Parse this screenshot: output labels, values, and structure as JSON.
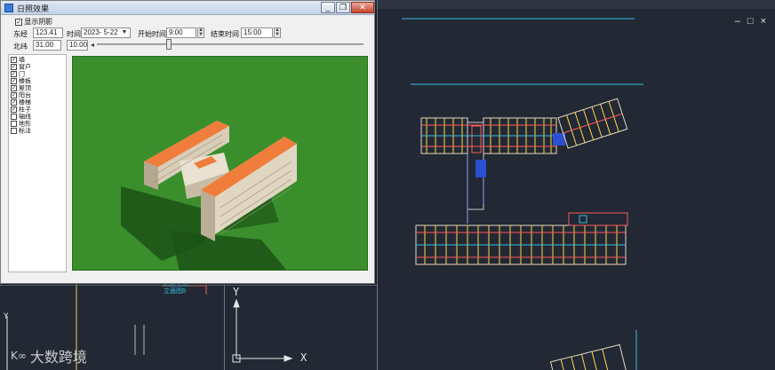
{
  "dialog": {
    "title": "日照效果",
    "show_shadow_label": "显示阴影",
    "show_shadow_checked": true,
    "location_label": "东经",
    "location_value": "123.41",
    "date_label": "时间",
    "date_value": "2023- 5-22",
    "start_label": "开始时间",
    "start_value": "9:00",
    "end_label": "结束时间",
    "end_value": "15:00",
    "lat_label": "北纬",
    "lat_value": "31.00",
    "speed_value": "10.00",
    "slider_level": 0.27,
    "layers": [
      "墙",
      "窗户",
      "门",
      "楼板",
      "屋顶",
      "阳台",
      "楼梯",
      "柱子",
      "轴线",
      "地形",
      "标注"
    ],
    "layers_checked": [
      true,
      true,
      true,
      true,
      true,
      true,
      true,
      true,
      false,
      false,
      false
    ]
  },
  "window_controls": {
    "minimize": "_",
    "restore": "❐",
    "close": "✕"
  },
  "cad": {
    "controls": [
      "–",
      "□",
      "×"
    ],
    "axis_x": "X",
    "axis_y": "Y",
    "label_lines": [
      "阳台立面",
      "立面图D"
    ],
    "colors": {
      "background": "#222834",
      "cyan": "#36c0e0",
      "wall": "#e8d9c0"
    }
  },
  "watermark": {
    "icon": "大数跨境-logo-icon",
    "text": "大数跨境"
  }
}
